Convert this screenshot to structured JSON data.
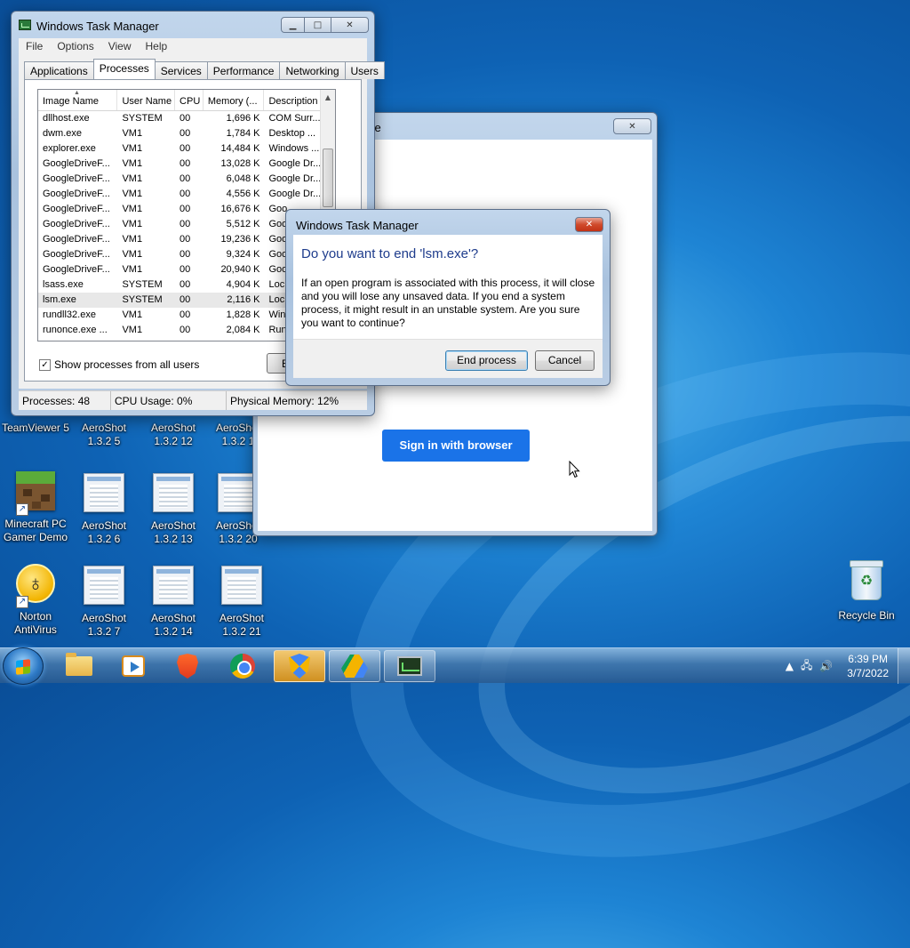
{
  "desktop": {
    "icons_col1": [
      {
        "label": "TeamViewer 5",
        "icon": "teamviewer-icon"
      },
      {
        "label": "Minecraft PC Gamer Demo",
        "icon": "minecraft-icon"
      },
      {
        "label": "Norton AntiVirus",
        "icon": "norton-icon"
      }
    ],
    "icons_grid": [
      {
        "label": "AeroShot 1.3.2 5"
      },
      {
        "label": "AeroShot 1.3.2 12"
      },
      {
        "label": "AeroShot 1.3.2 1"
      },
      {
        "label": "AeroShot 1.3.2 6"
      },
      {
        "label": "AeroShot 1.3.2 13"
      },
      {
        "label": "AeroShot 1.3.2 20"
      },
      {
        "label": "AeroShot 1.3.2 7"
      },
      {
        "label": "AeroShot 1.3.2 14"
      },
      {
        "label": "AeroShot 1.3.2 21"
      }
    ],
    "recycle_bin": "Recycle Bin"
  },
  "task_manager": {
    "title": "Windows Task Manager",
    "menu": [
      "File",
      "Options",
      "View",
      "Help"
    ],
    "tabs": [
      "Applications",
      "Processes",
      "Services",
      "Performance",
      "Networking",
      "Users"
    ],
    "active_tab": "Processes",
    "columns": [
      "Image Name",
      "User Name",
      "CPU",
      "Memory (...",
      "Description"
    ],
    "rows": [
      [
        "dllhost.exe",
        "SYSTEM",
        "00",
        "1,696 K",
        "COM Surr..."
      ],
      [
        "dwm.exe",
        "VM1",
        "00",
        "1,784 K",
        "Desktop ..."
      ],
      [
        "explorer.exe",
        "VM1",
        "00",
        "14,484 K",
        "Windows ..."
      ],
      [
        "GoogleDriveF...",
        "VM1",
        "00",
        "13,028 K",
        "Google Dr..."
      ],
      [
        "GoogleDriveF...",
        "VM1",
        "00",
        "6,048 K",
        "Google Dr..."
      ],
      [
        "GoogleDriveF...",
        "VM1",
        "00",
        "4,556 K",
        "Google Dr..."
      ],
      [
        "GoogleDriveF...",
        "VM1",
        "00",
        "16,676 K",
        "Goo"
      ],
      [
        "GoogleDriveF...",
        "VM1",
        "00",
        "5,512 K",
        "Goo"
      ],
      [
        "GoogleDriveF...",
        "VM1",
        "00",
        "19,236 K",
        "Goo"
      ],
      [
        "GoogleDriveF...",
        "VM1",
        "00",
        "9,324 K",
        "Goo"
      ],
      [
        "GoogleDriveF...",
        "VM1",
        "00",
        "20,940 K",
        "Goo"
      ],
      [
        "lsass.exe",
        "SYSTEM",
        "00",
        "4,904 K",
        "Loc"
      ],
      [
        "lsm.exe",
        "SYSTEM",
        "00",
        "2,116 K",
        "Loc"
      ],
      [
        "rundll32.exe",
        "VM1",
        "00",
        "1,828 K",
        "Win"
      ],
      [
        "runonce.exe ...",
        "VM1",
        "00",
        "2,084 K",
        "Run"
      ]
    ],
    "selected_row": 12,
    "show_all_label": "Show processes from all users",
    "end_button_fragment": "E",
    "status": {
      "processes": "Processes: 48",
      "cpu": "CPU Usage: 0%",
      "memory": "Physical Memory: 12%"
    }
  },
  "drive_window": {
    "title_fragment": "ve",
    "sign_in_button": "Sign in with browser"
  },
  "dialog": {
    "title": "Windows Task Manager",
    "heading": "Do you want to end 'lsm.exe'?",
    "message": "If an open program is associated with this process, it will close and you will lose any unsaved data. If you end a system process, it might result in an unstable system. Are you sure you want to continue?",
    "confirm": "End process",
    "cancel": "Cancel"
  },
  "taskbar": {
    "apps": [
      "explorer-icon",
      "media-player-icon",
      "brave-icon",
      "chrome-icon",
      "security-shield-icon",
      "google-drive-icon",
      "task-manager-icon"
    ],
    "time": "6:39 PM",
    "date": "3/7/2022"
  }
}
